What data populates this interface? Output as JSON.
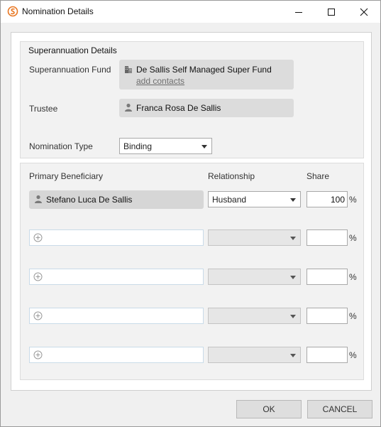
{
  "window": {
    "title": "Nomination Details"
  },
  "superannuation": {
    "section_title": "Superannuation Details",
    "fund_label": "Superannuation Fund",
    "fund_name": "De Sallis Self Managed Super Fund",
    "add_contacts_link": "add contacts",
    "trustee_label": "Trustee",
    "trustee_name": "Franca Rosa De Sallis",
    "nomination_type_label": "Nomination Type",
    "nomination_type_value": "Binding"
  },
  "beneficiaries": {
    "col_primary": "Primary Beneficiary",
    "col_relationship": "Relationship",
    "col_share": "Share",
    "percent_symbol": "%",
    "rows": [
      {
        "name": "Stefano Luca De Sallis",
        "relationship": "Husband",
        "share": "100"
      },
      {
        "name": "",
        "relationship": "",
        "share": ""
      },
      {
        "name": "",
        "relationship": "",
        "share": ""
      },
      {
        "name": "",
        "relationship": "",
        "share": ""
      },
      {
        "name": "",
        "relationship": "",
        "share": ""
      }
    ]
  },
  "buttons": {
    "ok": "OK",
    "cancel": "CANCEL"
  },
  "colors": {
    "accent": "#e87722",
    "readonly_field": "#dcdcdc",
    "group_background": "#f2f2f2"
  }
}
